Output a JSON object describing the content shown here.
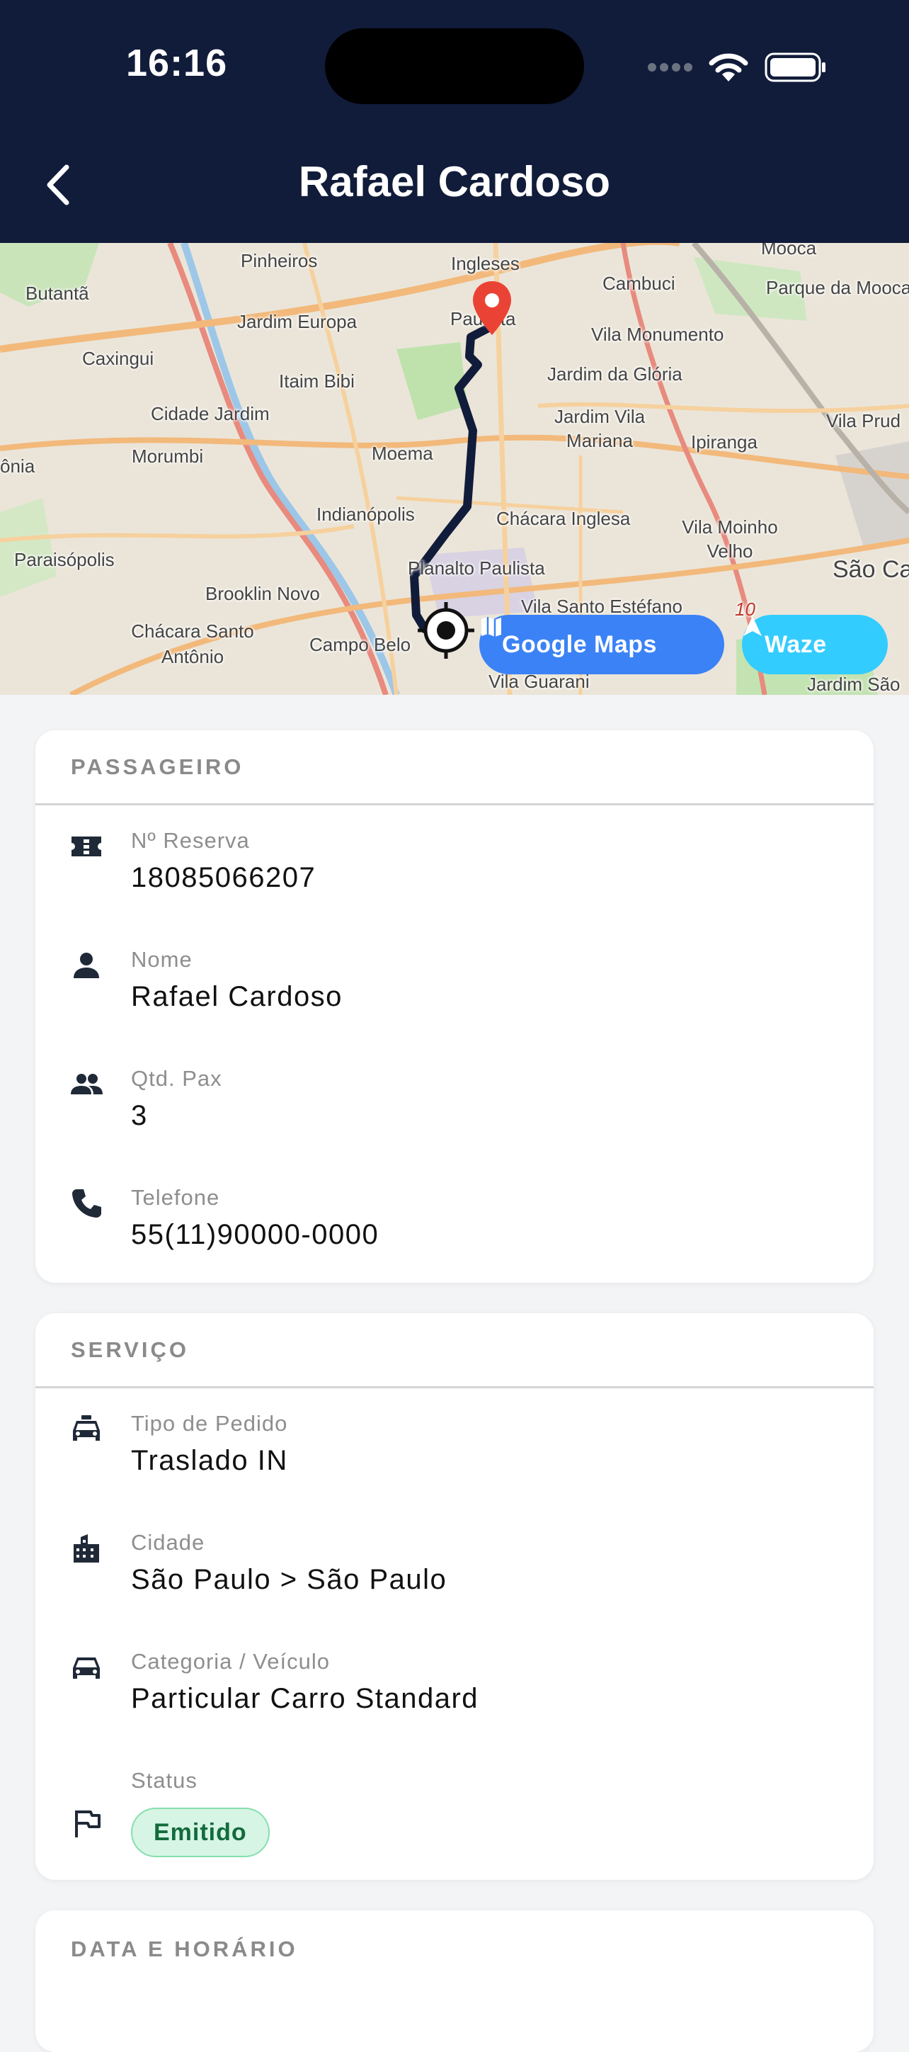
{
  "status_bar": {
    "time": "16:16"
  },
  "header": {
    "title": "Rafael Cardoso"
  },
  "map": {
    "labels": {
      "pinheiros": "Pinheiros",
      "ingleses": "Ingleses",
      "mooca": "Mooca",
      "butanta": "Butantã",
      "jardim_europa": "Jardim Europa",
      "paulista": "Paulista",
      "cambuci": "Cambuci",
      "parque_da_mooca": "Parque da Mooca",
      "caxingui": "Caxingui",
      "vila_monumento": "Vila Monumento",
      "itaim_bibi": "Itaim Bibi",
      "jardim_da_gloria": "Jardim da Glória",
      "cidade_jardim": "Cidade Jardim",
      "jardim_vila_mariana": "Jardim Vila Mariana",
      "vila_prud": "Vila Prud",
      "morumbi": "Morumbi",
      "moema": "Moema",
      "ipiranga": "Ipiranga",
      "sonia": "ônia",
      "indianopolis": "Indianópolis",
      "chacara_inglesa": "Chácara Inglesa",
      "vila_moinho_velho": "Vila Moinho Velho",
      "paraisopolis": "Paraisópolis",
      "planalto_paulista": "Planalto Paulista",
      "sao_ca": "São Ca",
      "brooklin_novo": "Brooklin Novo",
      "vila_santo_estefano": "Vila Santo Estéfano",
      "chacara_santo_antonio": "Chácara Santo Antônio",
      "campo_belo": "Campo Belo",
      "vila_guarani": "Vila Guarani",
      "jardim_sao": "Jardim São",
      "road_10": "10"
    },
    "google_maps_label": "Google Maps",
    "waze_label": "Waze",
    "colors": {
      "route": "#111c3a",
      "pin": "#ea4335",
      "google_maps": "#3b82f6",
      "waze": "#33ccff"
    }
  },
  "passageiro": {
    "heading": "PASSAGEIRO",
    "reserva_label": "Nº Reserva",
    "reserva_value": "18085066207",
    "nome_label": "Nome",
    "nome_value": "Rafael Cardoso",
    "pax_label": "Qtd. Pax",
    "pax_value": "3",
    "telefone_label": "Telefone",
    "telefone_value": "55(11)90000-0000"
  },
  "servico": {
    "heading": "SERVIÇO",
    "tipo_label": "Tipo de Pedido",
    "tipo_value": "Traslado IN",
    "cidade_label": "Cidade",
    "cidade_value": "São Paulo > São Paulo",
    "categoria_label": "Categoria / Veículo",
    "categoria_value": "Particular Carro Standard",
    "status_label": "Status",
    "status_value": "Emitido"
  },
  "data_horario": {
    "heading": "DATA E HORÁRIO"
  },
  "icons": [
    "back-arrow-icon",
    "wifi-icon",
    "battery-icon",
    "map-pin-icon",
    "crosshair-icon",
    "map-icon",
    "navigation-arrow-icon",
    "ticket-icon",
    "person-icon",
    "people-icon",
    "phone-icon",
    "taxi-icon",
    "city-icon",
    "car-icon",
    "flag-icon"
  ]
}
